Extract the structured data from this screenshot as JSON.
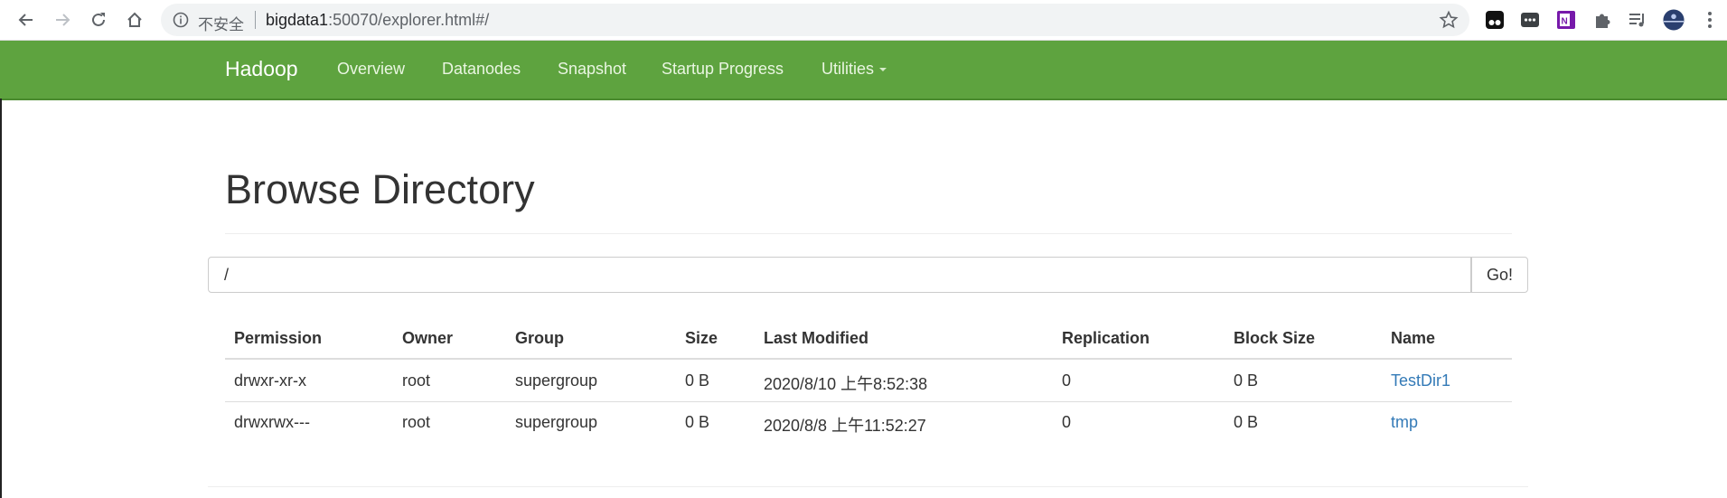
{
  "browser": {
    "security_label": "不安全",
    "url_host": "bigdata1",
    "url_rest": ":50070/explorer.html#/"
  },
  "navbar": {
    "brand": "Hadoop",
    "items": [
      {
        "label": "Overview"
      },
      {
        "label": "Datanodes"
      },
      {
        "label": "Snapshot"
      },
      {
        "label": "Startup Progress"
      },
      {
        "label": "Utilities"
      }
    ],
    "color": "#5ea33f"
  },
  "page": {
    "title": "Browse Directory",
    "path_value": "/",
    "go_label": "Go!"
  },
  "table": {
    "headers": [
      "Permission",
      "Owner",
      "Group",
      "Size",
      "Last Modified",
      "Replication",
      "Block Size",
      "Name"
    ],
    "rows": [
      [
        "drwxr-xr-x",
        "root",
        "supergroup",
        "0 B",
        "2020/8/10 上午8:52:38",
        "0",
        "0 B",
        "TestDir1"
      ],
      [
        "drwxrwx---",
        "root",
        "supergroup",
        "0 B",
        "2020/8/8 上午11:52:27",
        "0",
        "0 B",
        "tmp"
      ]
    ]
  },
  "icons": {
    "back": "back-arrow-icon",
    "forward": "forward-arrow-icon",
    "reload": "reload-icon",
    "home": "home-icon",
    "info": "info-icon",
    "star": "star-icon",
    "extensions": [
      "tampermonkey-icon",
      "chat-extension-icon",
      "onenote-icon",
      "puzzle-icon",
      "media-control-icon",
      "profile-avatar"
    ],
    "menu": "kebab-menu-icon"
  }
}
